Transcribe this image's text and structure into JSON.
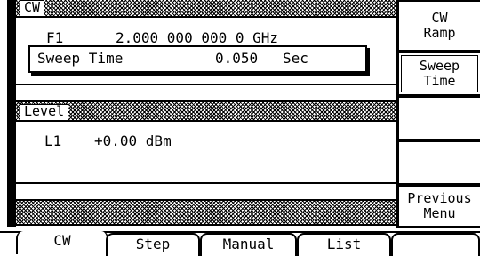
{
  "cw_panel": {
    "title": "CW",
    "freq_label": "F1",
    "freq_value": "2.000 000 000 0 GHz"
  },
  "sweep_time_field": {
    "label": "Sweep Time",
    "value": "0.050",
    "unit": "Sec"
  },
  "level_panel": {
    "title": "Level",
    "level_label": "L1",
    "level_value": "+0.00 dBm"
  },
  "softkeys": [
    {
      "line1": "CW",
      "line2": "Ramp"
    },
    {
      "line1": "Sweep",
      "line2": "Time"
    },
    {
      "line1": "",
      "line2": ""
    },
    {
      "line1": "",
      "line2": ""
    },
    {
      "line1": "Previous",
      "line2": "Menu"
    }
  ],
  "bottom_tabs": [
    "CW",
    "Step",
    "Manual",
    "List",
    ""
  ]
}
